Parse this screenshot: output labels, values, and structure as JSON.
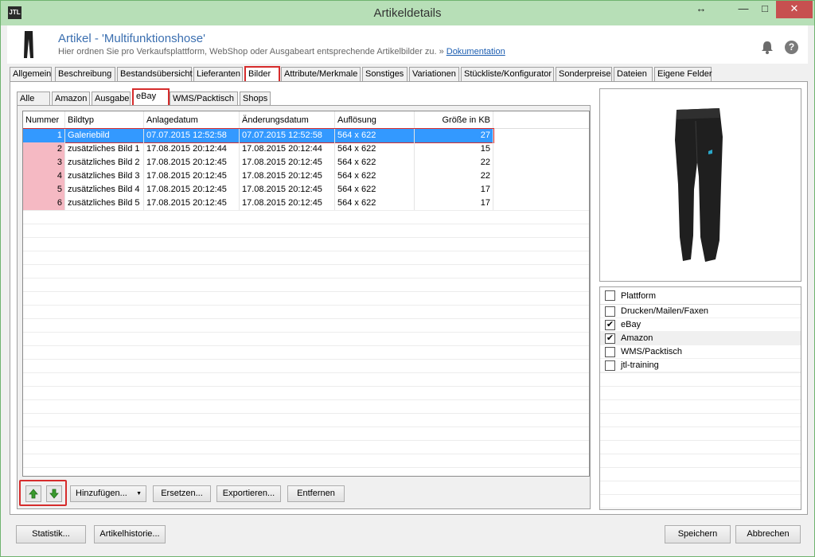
{
  "window": {
    "title": "Artikeldetails",
    "app_icon_text": "JTL",
    "controls": {
      "restore": "↔",
      "minimize": "—",
      "maximize": "□",
      "close": "✕"
    }
  },
  "header": {
    "title": "Artikel - 'Multifunktionshose'",
    "subtitle": "Hier ordnen Sie pro Verkaufsplattform, WebShop oder Ausgabeart entsprechende Artikelbilder zu. » ",
    "link": "Dokumentation"
  },
  "main_tabs": [
    "Allgemein",
    "Beschreibung",
    "Bestandsübersicht",
    "Lieferanten",
    "Bilder",
    "Attribute/Merkmale",
    "Sonstiges",
    "Variationen",
    "Stückliste/Konfigurator",
    "Sonderpreise",
    "Dateien",
    "Eigene Felder"
  ],
  "sub_tabs": [
    "Alle",
    "Amazon",
    "Ausgabe",
    "eBay",
    "WMS/Packtisch",
    "Shops"
  ],
  "table": {
    "columns": [
      "Nummer",
      "Bildtyp",
      "Anlagedatum",
      "Änderungsdatum",
      "Auflösung",
      "Größe in KB"
    ],
    "rows": [
      [
        "1",
        "Galeriebild",
        "07.07.2015 12:52:58",
        "07.07.2015 12:52:58",
        "564 x 622",
        "27"
      ],
      [
        "2",
        "zusätzliches Bild 1",
        "17.08.2015 20:12:44",
        "17.08.2015 20:12:44",
        "564 x 622",
        "15"
      ],
      [
        "3",
        "zusätzliches Bild 2",
        "17.08.2015 20:12:45",
        "17.08.2015 20:12:45",
        "564 x 622",
        "22"
      ],
      [
        "4",
        "zusätzliches Bild 3",
        "17.08.2015 20:12:45",
        "17.08.2015 20:12:45",
        "564 x 622",
        "22"
      ],
      [
        "5",
        "zusätzliches Bild 4",
        "17.08.2015 20:12:45",
        "17.08.2015 20:12:45",
        "564 x 622",
        "17"
      ],
      [
        "6",
        "zusätzliches Bild 5",
        "17.08.2015 20:12:45",
        "17.08.2015 20:12:45",
        "564 x 622",
        "17"
      ]
    ]
  },
  "list_buttons": {
    "add": "Hinzufügen...",
    "replace": "Ersetzen...",
    "export": "Exportieren...",
    "remove": "Entfernen"
  },
  "platforms": {
    "header": "Plattform",
    "items": [
      {
        "label": "Drucken/Mailen/Faxen",
        "checked": ""
      },
      {
        "label": "eBay",
        "checked": "✔"
      },
      {
        "label": "Amazon",
        "checked": "✔"
      },
      {
        "label": "WMS/Packtisch",
        "checked": ""
      },
      {
        "label": "jtl-training",
        "checked": ""
      }
    ]
  },
  "footer": {
    "statistics": "Statistik...",
    "history": "Artikelhistorie...",
    "save": "Speichern",
    "cancel": "Abbrechen"
  },
  "colors": {
    "selection": "#3399ff",
    "highlight": "#d62c2c",
    "number_cell": "#f5b9c3",
    "title_bar": "#b7dfb7"
  }
}
